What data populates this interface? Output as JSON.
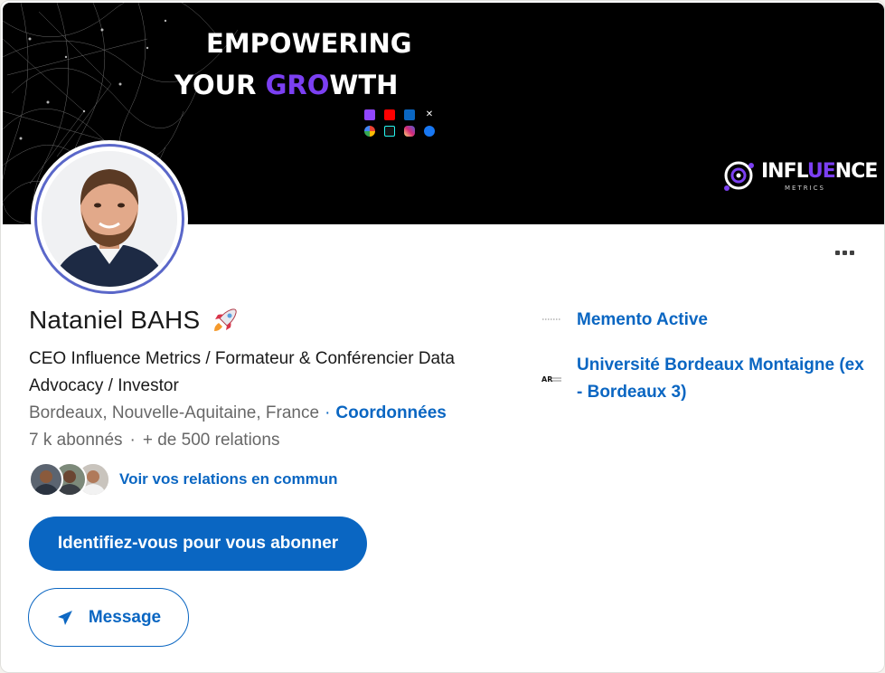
{
  "banner": {
    "line1": "EMPOWERING",
    "line2_part1": "YOUR ",
    "line2_accent": "GRO",
    "line2_part2": "WTH",
    "logo_text_part1": "INFL",
    "logo_text_accent": "UE",
    "logo_text_part2": "NCE",
    "logo_sub": "METRICS",
    "social_icons": [
      "twitch-icon",
      "youtube-icon",
      "linkedin-icon",
      "x-icon",
      "google-icon",
      "tiktok-icon",
      "instagram-icon",
      "facebook-icon"
    ]
  },
  "profile": {
    "name": "Nataniel BAHS",
    "headline": "CEO Influence Metrics / Formateur & Conférencier Data Advocacy / Investor",
    "location": "Bordeaux, Nouvelle-Aquitaine, France",
    "separator": "·",
    "contact_label": "Coordonnées",
    "followers": "7 k abonnés",
    "connections": "+ de 500 relations",
    "mutual_label": "Voir vos relations en commun"
  },
  "actions": {
    "follow_label": "Identifiez-vous pour vous abonner",
    "message_label": "Message"
  },
  "organizations": [
    {
      "name": "Memento Active",
      "logo": "memento-logo"
    },
    {
      "name": "Université Bordeaux Montaigne (ex - Bordeaux 3)",
      "logo": "university-logo"
    }
  ],
  "colors": {
    "primary": "#0a66c2",
    "banner_accent": "#7b3ff2",
    "avatar_ring": "#5a67c9"
  }
}
